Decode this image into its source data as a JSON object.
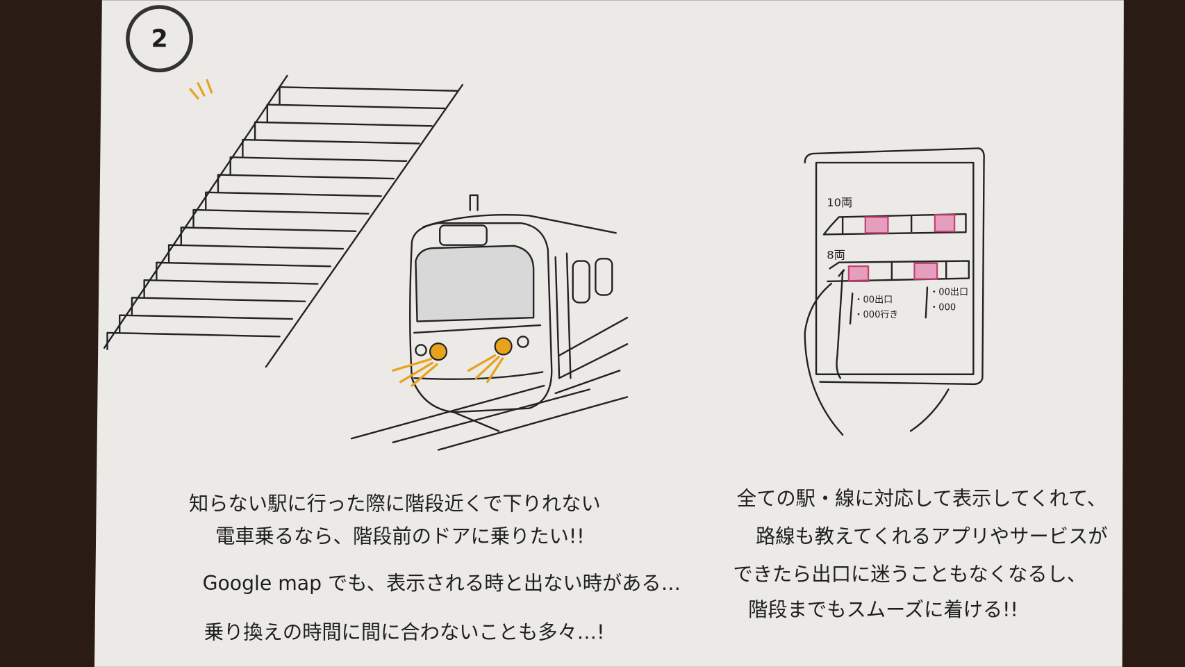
{
  "page_number": "2",
  "colors": {
    "wood": "#2a1c14",
    "paper": "#ebeae6",
    "ink": "#222222",
    "orange": "#e8a21c",
    "pink": "#e0609a"
  },
  "phone_screen": {
    "train_10_label": "10両",
    "train_8_label": "8両",
    "info_left": [
      "・00出口",
      "・000行き"
    ],
    "info_right": [
      "・00出口",
      "・000"
    ]
  },
  "left_notes": [
    "知らない駅に行った際に階段近くで下りれない",
    "電車乗るなら、階段前のドアに乗りたい!!",
    "Google map でも、表示される時と出ない時がある…",
    "乗り換えの時間に間に合わないことも多々…!"
  ],
  "right_notes": [
    "全ての駅・線に対応して表示してくれて、",
    "路線も教えてくれるアプリやサービスが",
    "できたら出口に迷うこともなくなるし、",
    "階段までもスムーズに着ける!!"
  ]
}
